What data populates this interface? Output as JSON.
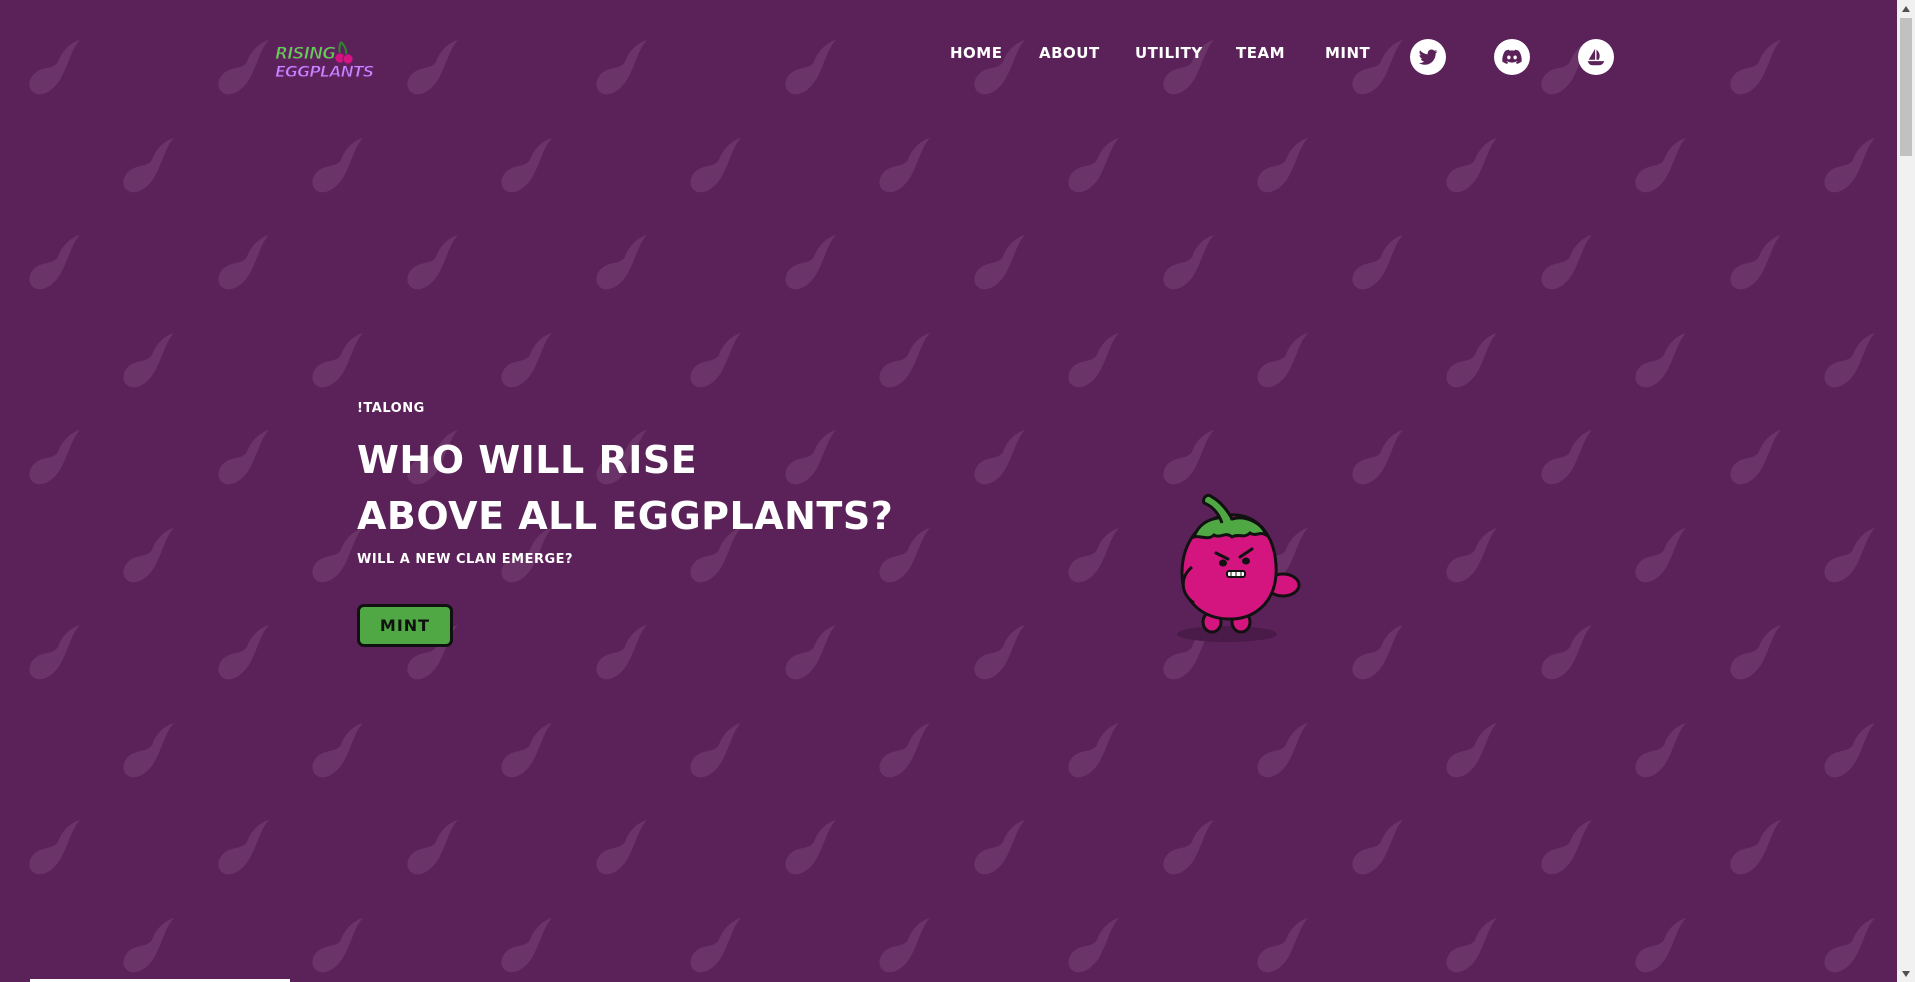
{
  "colors": {
    "background": "#5a2259",
    "pattern": "#6b3468",
    "text": "#ffffff",
    "mint_button_bg": "#4fa843",
    "mascot_body": "#d4157f",
    "mascot_leaf": "#4fa843"
  },
  "header": {
    "logo": {
      "line1": "RISING",
      "line2": "EGGPLANTS",
      "icon": "cherry-icon"
    },
    "nav": [
      {
        "label": "HOME"
      },
      {
        "label": "ABOUT"
      },
      {
        "label": "UTILITY"
      },
      {
        "label": "TEAM"
      },
      {
        "label": "MINT"
      }
    ],
    "social": [
      {
        "icon": "twitter-icon"
      },
      {
        "icon": "discord-icon"
      },
      {
        "icon": "opensea-icon"
      }
    ]
  },
  "hero": {
    "kicker": "!TALONG",
    "title_line1": "WHO WILL RISE",
    "title_line2": "ABOVE ALL EGGPLANTS?",
    "subtitle": "WILL A NEW CLAN EMERGE?",
    "mint_label": "MINT",
    "mascot_icon": "angry-eggplant-mascot"
  }
}
